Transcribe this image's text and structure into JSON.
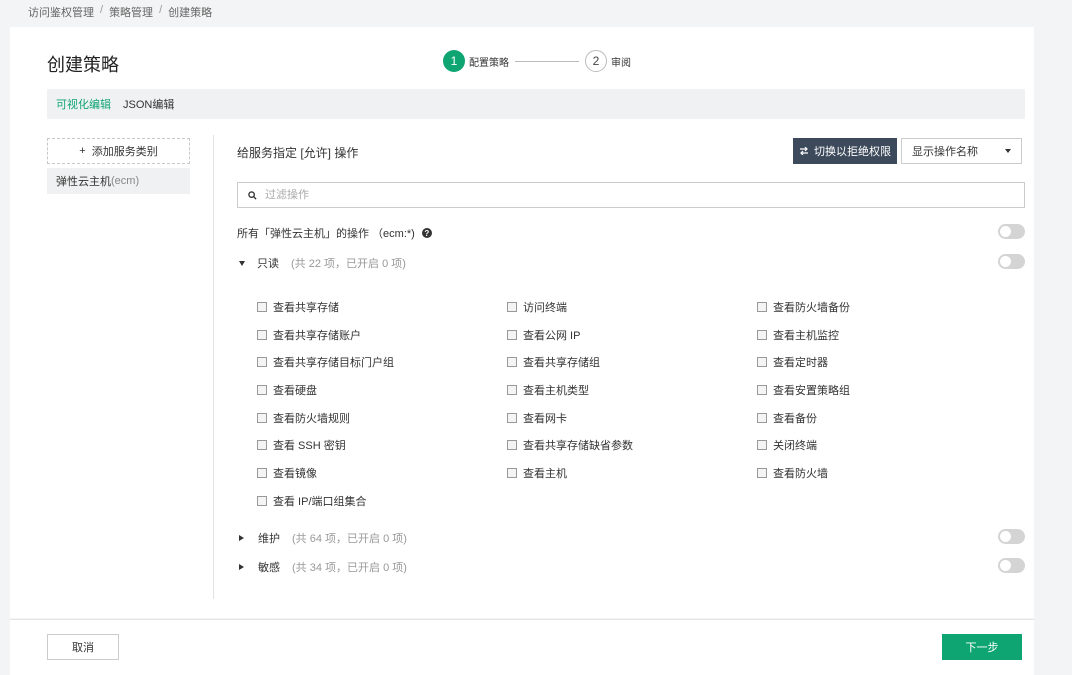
{
  "breadcrumb": [
    "访问鉴权管理",
    "策略管理",
    "创建策略"
  ],
  "page_title": "创建策略",
  "steps": [
    {
      "num": "1",
      "label": "配置策略"
    },
    {
      "num": "2",
      "label": "审阅"
    }
  ],
  "modes": {
    "visual": "可视化编辑",
    "json": "JSON编辑"
  },
  "sidebar": {
    "add_label": "添加服务类别",
    "add_icon": "+",
    "service_name": "弹性云主机",
    "service_code": "(ecm)"
  },
  "main": {
    "title": "给服务指定 [允许] 操作",
    "switch_label": "切换以拒绝权限",
    "display_select": "显示操作名称",
    "filter_placeholder": "过滤操作",
    "all_actions": "所有「弹性云主机」的操作 （ecm:*)"
  },
  "groups": [
    {
      "name": "只读",
      "count": "(共 22 项，已开启 0 项)"
    },
    {
      "name": "维护",
      "count": "(共 64 项，已开启 0 项)"
    },
    {
      "name": "敏感",
      "count": "(共 34 项，已开启 0 项)"
    }
  ],
  "readonly_ops": [
    "查看共享存储",
    "访问终端",
    "查看防火墙备份",
    "查看共享存储账户",
    "查看公网 IP",
    "查看主机监控",
    "查看共享存储目标门户组",
    "查看共享存储组",
    "查看定时器",
    "查看硬盘",
    "查看主机类型",
    "查看安置策略组",
    "查看防火墙规则",
    "查看网卡",
    "查看备份",
    "查看 SSH 密钥",
    "查看共享存储缺省参数",
    "关闭终端",
    "查看镜像",
    "查看主机",
    "查看防火墙",
    "查看 IP/端口组集合"
  ],
  "footer": {
    "cancel": "取消",
    "next": "下一步"
  },
  "colors": {
    "accent": "#0fa572",
    "dark_button": "#3d4a5c",
    "toggle_off": "#d4d4d4"
  }
}
